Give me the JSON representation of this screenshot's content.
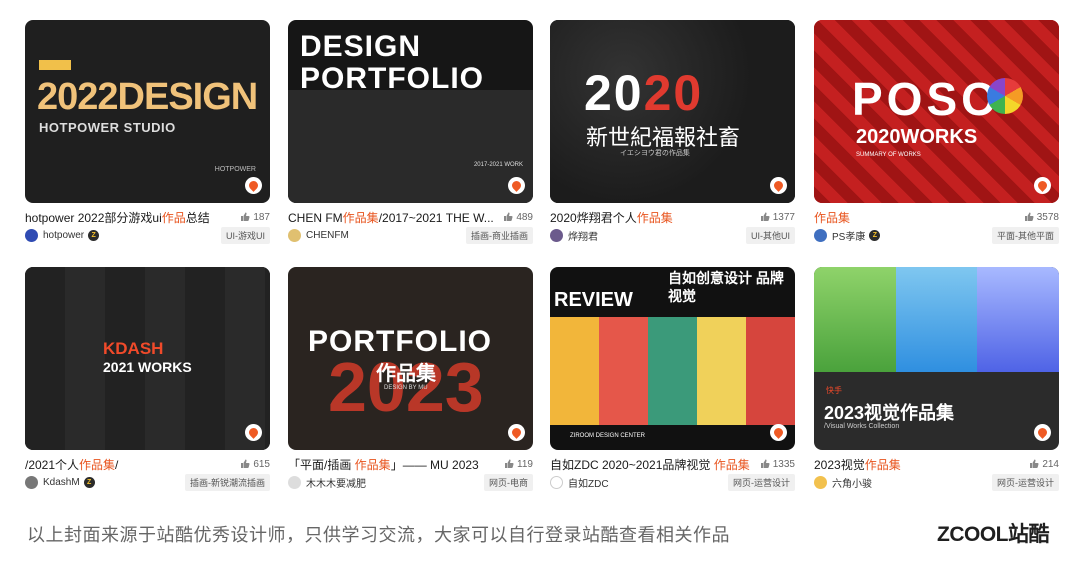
{
  "cards": [
    {
      "cover": {
        "line1": "2022DESIGN",
        "line2": "HOTPOWER STUDIO",
        "corner": "HOTPOWER"
      },
      "title_pre": "hotpower 2022部分游戏ui",
      "title_hl": "作品",
      "title_post": "总结",
      "likes": "187",
      "author": "hotpower",
      "tag": "UI-游戏UI"
    },
    {
      "cover": {
        "line1": "DESIGN",
        "line2": "PORTFOLIO",
        "corner": "2017-2021 WORK"
      },
      "title_pre": "CHEN FM",
      "title_hl": "作品集",
      "title_post": "/2017~2021 THE W...",
      "likes": "489",
      "author": "CHENFM",
      "tag": "插画-商业插画"
    },
    {
      "cover": {
        "line1": "2020",
        "line2": "新世紀福報社畜",
        "corner": "イエシヨウ君の作品集"
      },
      "title_pre": "2020烨翔君个人",
      "title_hl": "作品集",
      "title_post": "",
      "likes": "1377",
      "author": "烨翔君",
      "tag": "UI-其他UI"
    },
    {
      "cover": {
        "line1": "POSO",
        "line2": "2020WORKS",
        "corner": "SUMMARY OF WORKS"
      },
      "title_pre": "",
      "title_hl": "作品集",
      "title_post": "",
      "likes": "3578",
      "author": "PS孝康",
      "tag": "平面-其他平面"
    },
    {
      "cover": {
        "line1": "KDASH",
        "line2": "2021 WORKS",
        "corner": ""
      },
      "title_pre": "/2021个人",
      "title_hl": "作品集",
      "title_post": "/",
      "likes": "615",
      "author": "KdashM",
      "tag": "插画-新锐潮流插画"
    },
    {
      "cover": {
        "line1": "PORTFOLIO",
        "line2": "作品集",
        "corner": "DESIGN BY MU"
      },
      "title_pre": "「平面/插画 ",
      "title_hl": "作品集",
      "title_post": "」—— MU 2023",
      "likes": "119",
      "author": "木木木要减肥",
      "tag": "网页-电商"
    },
    {
      "cover": {
        "line1": "REVIEW",
        "line2": "自如创意设计 品牌视觉",
        "corner": "ZIROOM DESIGN CENTER"
      },
      "title_pre": "自如ZDC 2020~2021品牌视觉 ",
      "title_hl": "作品集",
      "title_post": "",
      "likes": "1335",
      "author": "自如ZDC",
      "tag": "网页-运营设计"
    },
    {
      "cover": {
        "line1": "2023视觉作品集",
        "line2": "/Visual Works Collection",
        "corner": "快手"
      },
      "title_pre": "2023视觉",
      "title_hl": "作品集",
      "title_post": "",
      "likes": "214",
      "author": "六角小骏",
      "tag": "网页-运营设计"
    }
  ],
  "footer": {
    "note": "以上封面来源于站酷优秀设计师，只供学习交流，大家可以自行登录站酷查看相关作品",
    "brand": "ZCOOL站酷"
  },
  "colors": {
    "highlight": "#e8541e",
    "fire": "#ef5a24"
  }
}
